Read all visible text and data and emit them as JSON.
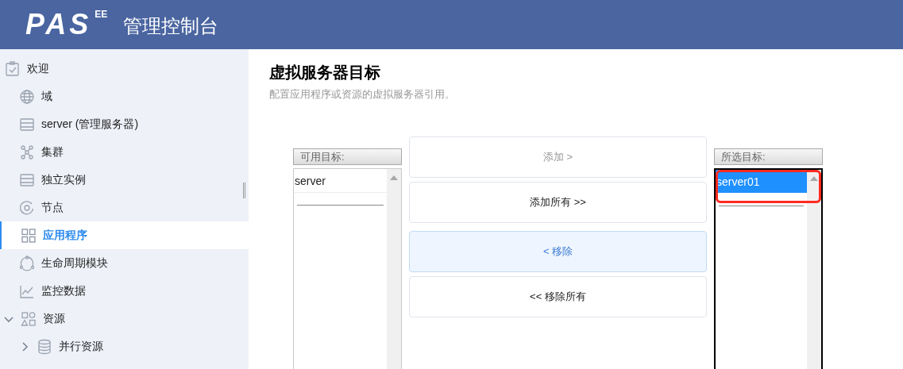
{
  "header": {
    "logo": "PAS",
    "logo_sup": "EE",
    "title": "管理控制台"
  },
  "sidebar": {
    "items": [
      {
        "label": "欢迎",
        "selected": false
      },
      {
        "label": "域",
        "selected": false
      },
      {
        "label": "server (管理服务器)",
        "selected": false
      },
      {
        "label": "集群",
        "selected": false
      },
      {
        "label": "独立实例",
        "selected": false
      },
      {
        "label": "节点",
        "selected": false
      },
      {
        "label": "应用程序",
        "selected": true
      },
      {
        "label": "生命周期模块",
        "selected": false
      },
      {
        "label": "监控数据",
        "selected": false
      },
      {
        "label": "资源",
        "selected": false,
        "expanded": true,
        "children": [
          {
            "label": "并行资源",
            "selected": false,
            "expanded": false
          }
        ]
      }
    ]
  },
  "page": {
    "title": "虚拟服务器目标",
    "subtitle": "配置应用程序或资源的虚拟服务器引用。"
  },
  "available": {
    "header": "可用目标:",
    "focused": false,
    "items": [
      {
        "label": "server",
        "selected": false
      }
    ]
  },
  "buttons": [
    {
      "label": "添加 >",
      "disabled": true,
      "focused": false
    },
    {
      "label": "添加所有 >>",
      "disabled": false,
      "focused": false
    },
    {
      "label": "< 移除",
      "disabled": false,
      "focused": true
    },
    {
      "label": "<< 移除所有",
      "disabled": false,
      "focused": false
    }
  ],
  "chosen": {
    "header": "所选目标:",
    "focused": true,
    "highlighted": true,
    "items": [
      {
        "label": "server01",
        "selected": true
      }
    ]
  }
}
